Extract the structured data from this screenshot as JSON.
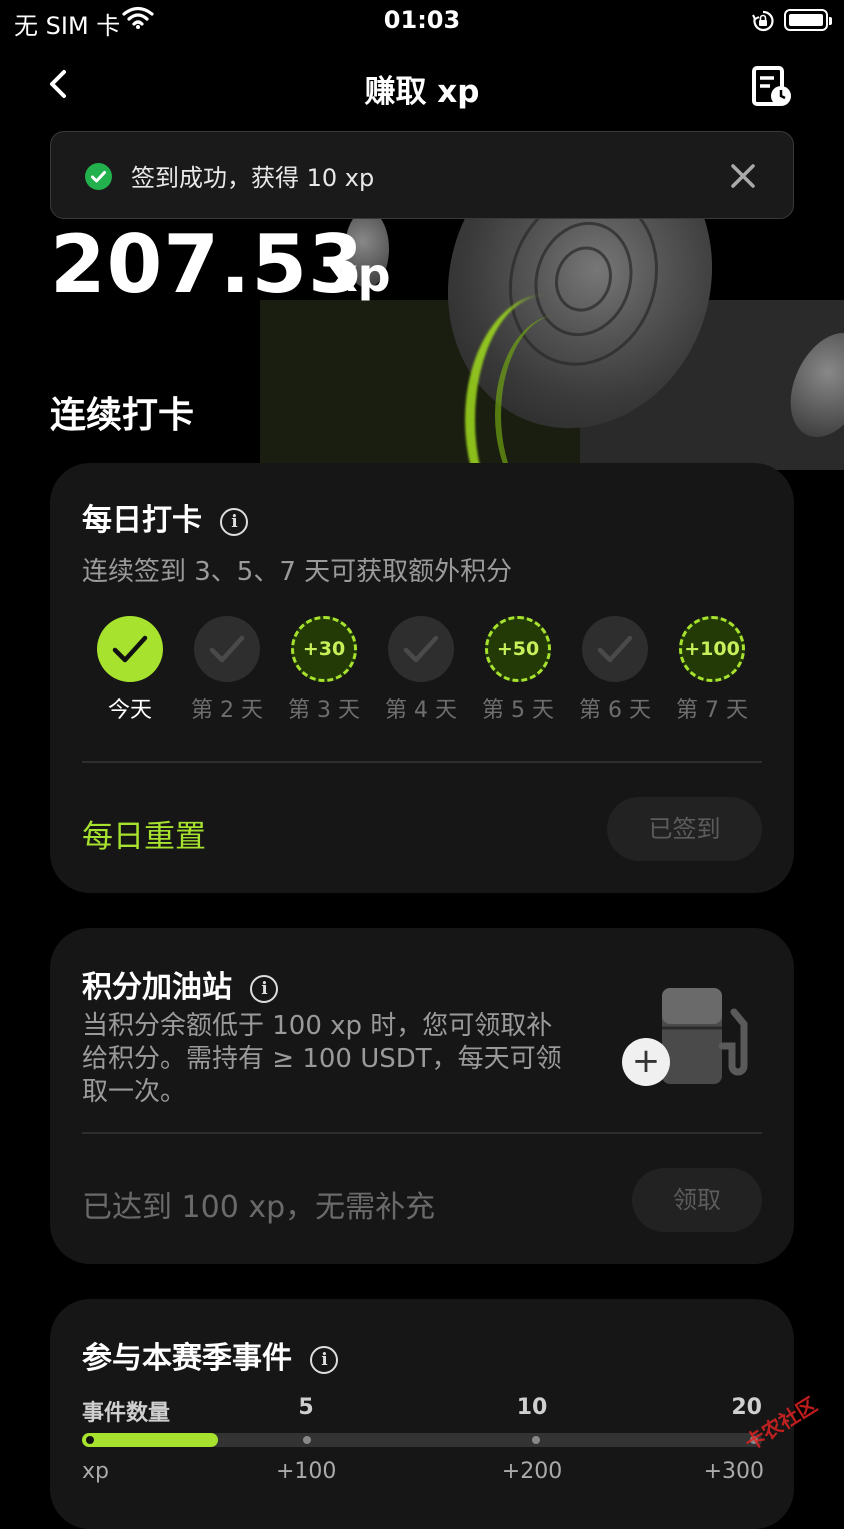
{
  "status_bar": {
    "carrier": "无 SIM 卡",
    "time": "01:03"
  },
  "header": {
    "title": "赚取 xp"
  },
  "toast": {
    "message": "签到成功，获得 10 xp"
  },
  "balance": {
    "value": "207.53",
    "unit": "xp"
  },
  "streak_heading": "连续打卡",
  "daily_checkin": {
    "title": "每日打卡",
    "subtitle": "连续签到 3、5、7 天可获取额外积分",
    "days": [
      {
        "label": "今天",
        "state": "done",
        "bonus": ""
      },
      {
        "label": "第 2 天",
        "state": "pending",
        "bonus": ""
      },
      {
        "label": "第 3 天",
        "state": "bonus",
        "bonus": "+30"
      },
      {
        "label": "第 4 天",
        "state": "pending",
        "bonus": ""
      },
      {
        "label": "第 5 天",
        "state": "bonus",
        "bonus": "+50"
      },
      {
        "label": "第 6 天",
        "state": "pending",
        "bonus": ""
      },
      {
        "label": "第 7 天",
        "state": "bonus",
        "bonus": "+100"
      }
    ],
    "reset_label": "每日重置",
    "button_label": "已签到"
  },
  "refuel": {
    "title": "积分加油站",
    "description_lines": [
      "当积分余额低于 100 xp 时，您可领取补",
      "给积分。需持有 ≥ 100 USDT，每天可领",
      "取一次。"
    ],
    "status": "已达到 100 xp，无需补充",
    "button_label": "领取"
  },
  "events": {
    "title": "参与本赛季事件",
    "row1_label": "事件数量",
    "milestones": [
      "5",
      "10",
      "20"
    ],
    "row2_label": "xp",
    "rewards": [
      "+100",
      "+200",
      "+300"
    ],
    "progress": 0.2
  },
  "watermark": "卡农社区",
  "colors": {
    "accent": "#a6e22e",
    "success": "#22b14c",
    "card": "#161616",
    "background": "#000000"
  },
  "icons": [
    "back-arrow-icon",
    "history-icon",
    "check-circle-icon",
    "close-icon",
    "info-icon",
    "check-icon",
    "fuel-pump-icon",
    "plus-icon",
    "wifi-icon",
    "lock-rotation-icon",
    "battery-icon"
  ]
}
